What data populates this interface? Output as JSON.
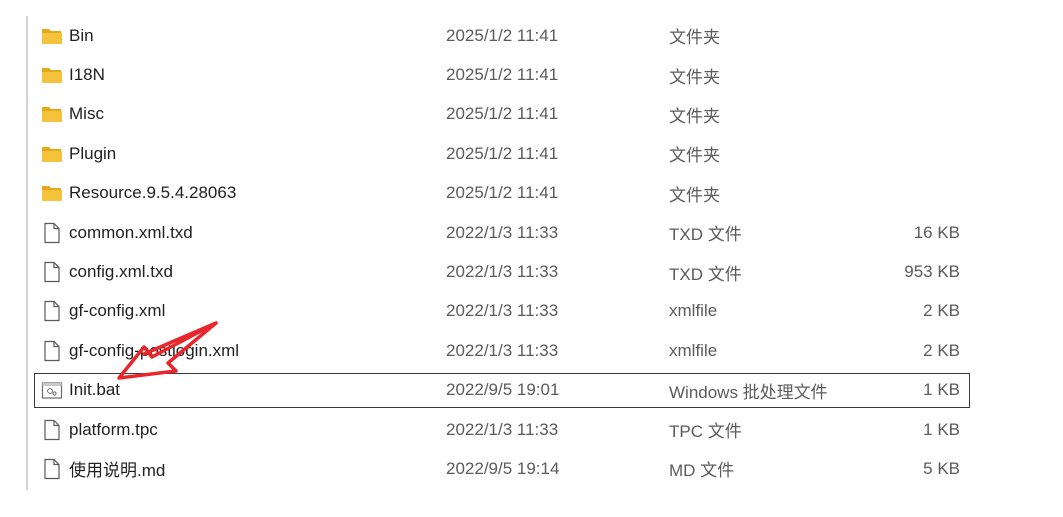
{
  "files": [
    {
      "name": "Bin",
      "date": "2025/1/2 11:41",
      "type": "文件夹",
      "size": "",
      "icon": "folder-icon"
    },
    {
      "name": "I18N",
      "date": "2025/1/2 11:41",
      "type": "文件夹",
      "size": "",
      "icon": "folder-icon"
    },
    {
      "name": "Misc",
      "date": "2025/1/2 11:41",
      "type": "文件夹",
      "size": "",
      "icon": "folder-icon"
    },
    {
      "name": "Plugin",
      "date": "2025/1/2 11:41",
      "type": "文件夹",
      "size": "",
      "icon": "folder-icon"
    },
    {
      "name": "Resource.9.5.4.28063",
      "date": "2025/1/2 11:41",
      "type": "文件夹",
      "size": "",
      "icon": "folder-icon"
    },
    {
      "name": "common.xml.txd",
      "date": "2022/1/3 11:33",
      "type": "TXD 文件",
      "size": "16 KB",
      "icon": "file-icon"
    },
    {
      "name": "config.xml.txd",
      "date": "2022/1/3 11:33",
      "type": "TXD 文件",
      "size": "953 KB",
      "icon": "file-icon"
    },
    {
      "name": "gf-config.xml",
      "date": "2022/1/3 11:33",
      "type": "xmlfile",
      "size": "2 KB",
      "icon": "file-icon"
    },
    {
      "name": "gf-config-postlogin.xml",
      "date": "2022/1/3 11:33",
      "type": "xmlfile",
      "size": "2 KB",
      "icon": "file-icon"
    },
    {
      "name": "Init.bat",
      "date": "2022/9/5 19:01",
      "type": "Windows 批处理文件",
      "size": "1 KB",
      "icon": "batch-file-icon",
      "selected": true
    },
    {
      "name": "platform.tpc",
      "date": "2022/1/3 11:33",
      "type": "TPC 文件",
      "size": "1 KB",
      "icon": "file-icon"
    },
    {
      "name": "使用说明.md",
      "date": "2022/9/5 19:14",
      "type": "MD 文件",
      "size": "5 KB",
      "icon": "file-icon"
    }
  ],
  "colors": {
    "folder": "#f5c33b",
    "folder_dark": "#e2a91c",
    "arrow": "#e8262c",
    "selection_border": "#3a3a3a"
  }
}
